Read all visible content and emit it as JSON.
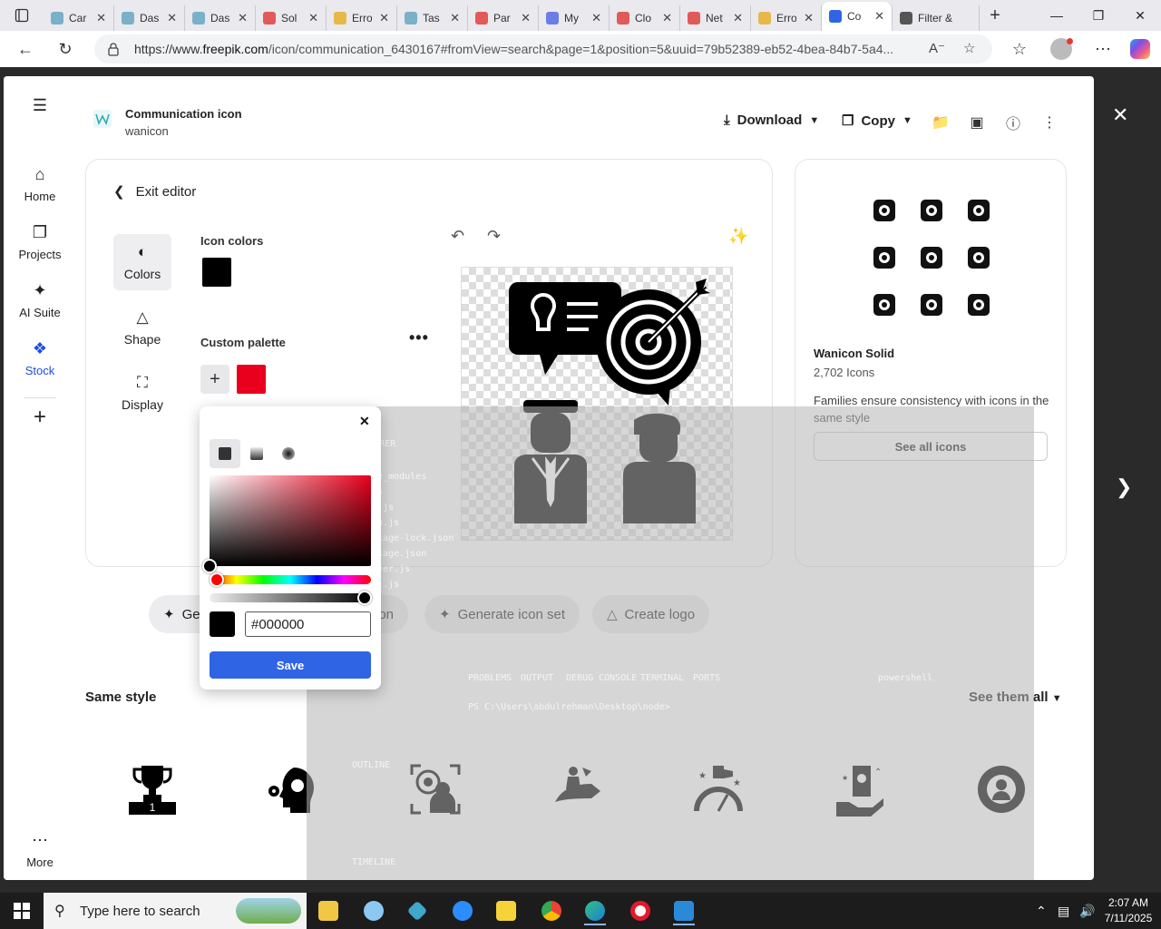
{
  "browser": {
    "tabs": [
      {
        "label": "Car",
        "color": "#7ab0c8"
      },
      {
        "label": "Das",
        "color": "#7ab0c8"
      },
      {
        "label": "Das",
        "color": "#7ab0c8"
      },
      {
        "label": "Sol",
        "color": "#e05a5a"
      },
      {
        "label": "Erro",
        "color": "#e6b84a"
      },
      {
        "label": "Tas",
        "color": "#7ab0c8"
      },
      {
        "label": "Par",
        "color": "#e05a5a"
      },
      {
        "label": "My",
        "color": "#6a7ee6"
      },
      {
        "label": "Clo",
        "color": "#e05a5a"
      },
      {
        "label": "Net",
        "color": "#e05a5a"
      },
      {
        "label": "Erro",
        "color": "#e6b84a"
      },
      {
        "label": "Co",
        "color": "#2f64e5"
      },
      {
        "label": "Filter &",
        "color": "#555555"
      }
    ],
    "url_prefix": "https://www.",
    "url_host": "freepik.com",
    "url_path": "/icon/communication_6430167#fromView=search&page=1&position=5&uuid=79b52389-eb52-4bea-84b7-5a4..."
  },
  "leftnav": {
    "home": "Home",
    "projects": "Projects",
    "ai_suite": "AI Suite",
    "stock": "Stock",
    "more": "More"
  },
  "header": {
    "title": "Communication icon",
    "author": "wanicon",
    "download": "Download",
    "copy": "Copy"
  },
  "editor": {
    "exit": "Exit editor",
    "tools": {
      "colors": "Colors",
      "shape": "Shape",
      "display": "Display"
    },
    "icon_colors_label": "Icon colors",
    "icon_color": "#000000",
    "custom_palette_label": "Custom palette",
    "palette_color": "#e8001c"
  },
  "picker": {
    "hex_value": "#000000",
    "save": "Save"
  },
  "family": {
    "title": "Wanicon Solid",
    "count": "2,702 Icons",
    "description": "Families ensure consistency with icons in the same style",
    "see_all": "See all icons"
  },
  "chips": {
    "generate": "Gen",
    "generate_icon_tail": "on",
    "generate_set": "Generate icon set",
    "create_logo": "Create logo"
  },
  "same_style": {
    "title": "Same style",
    "see_them_all": "See them all"
  },
  "ghost": {
    "explorer": "EXPLORER",
    "node": "NODE",
    "files": [
      "node_modules",
      "1.js",
      "app.js",
      "main.js",
      "package-lock.json",
      "package.json",
      "server.js",
      "test.js"
    ],
    "outline": "OUTLINE",
    "timeline": "TIMELINE",
    "terminal_tabs": [
      "PROBLEMS",
      "OUTPUT",
      "DEBUG CONSOLE",
      "TERMINAL",
      "PORTS"
    ],
    "prompt": "PS C:\\Users\\abdulrehman\\Desktop\\node>",
    "shell": "powershell"
  },
  "taskbar": {
    "search_placeholder": "Type here to search",
    "time": "2:07 AM",
    "date": "7/11/2025"
  }
}
